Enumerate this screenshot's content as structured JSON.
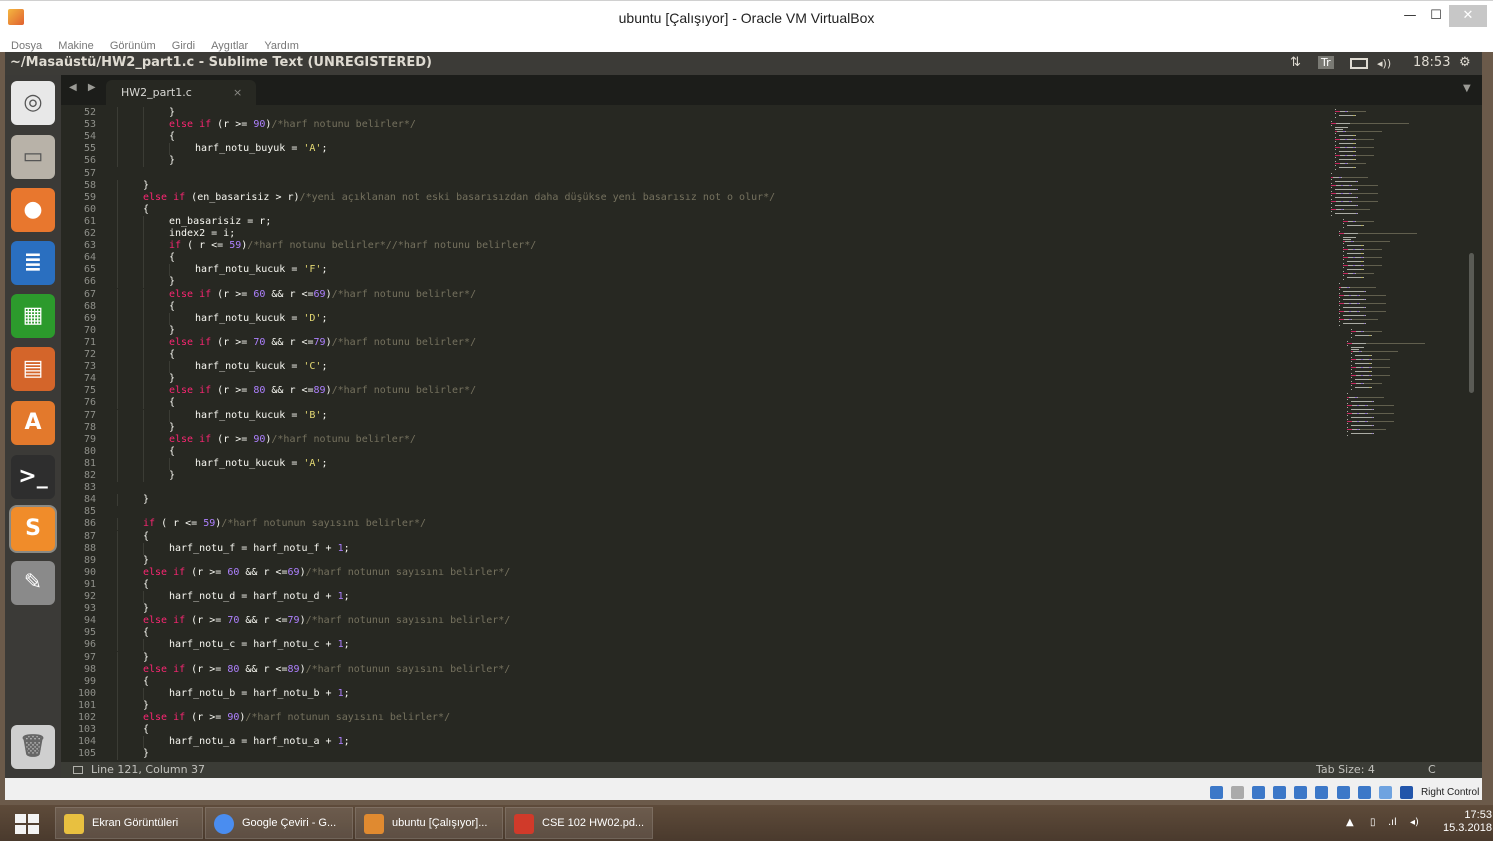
{
  "window": {
    "title": "ubuntu [Çalışıyor] - Oracle VM VirtualBox",
    "min": "—",
    "max": "☐",
    "close": "✕"
  },
  "vb_menu": [
    "Dosya",
    "Makine",
    "Görünüm",
    "Girdi",
    "Aygıtlar",
    "Yardım"
  ],
  "panel": {
    "title": "~/Masaüstü/HW2_part1.c - Sublime Text (UNREGISTERED)",
    "network": "⇅",
    "keyboard": "Tr",
    "volume": "◂))",
    "time": "18:53",
    "settings": "⚙"
  },
  "launcher": [
    {
      "name": "ubuntu-dash-icon",
      "glyph": "◎",
      "color": "#e8e8e8"
    },
    {
      "name": "files-icon",
      "glyph": "▭",
      "color": "#b8b2a8"
    },
    {
      "name": "firefox-icon",
      "glyph": "●",
      "color": "#e8772e"
    },
    {
      "name": "writer-icon",
      "glyph": "≣",
      "color": "#2a6fc0"
    },
    {
      "name": "calc-icon",
      "glyph": "▦",
      "color": "#2c9a2c"
    },
    {
      "name": "impress-icon",
      "glyph": "▤",
      "color": "#d4652a"
    },
    {
      "name": "software-center-icon",
      "glyph": "A",
      "color": "#e3792c"
    },
    {
      "name": "terminal-icon",
      "glyph": ">_",
      "color": "#2e2e2e"
    },
    {
      "name": "sublime-text-icon",
      "glyph": "S",
      "color": "#f08c2a"
    },
    {
      "name": "system-settings-icon",
      "glyph": "✎",
      "color": "#8a8a8a"
    }
  ],
  "launcher_trash": {
    "name": "trash-icon",
    "glyph": "🗑"
  },
  "tabs": {
    "nav": "◀ ▶",
    "active": "HW2_part1.c",
    "close": "×",
    "dropdown": "▼"
  },
  "editor": {
    "lines": [
      {
        "n": "52",
        "indent": 2,
        "t": [
          [
            "p",
            "}"
          ]
        ]
      },
      {
        "n": "53",
        "indent": 2,
        "t": [
          [
            "k",
            "else if"
          ],
          [
            "p",
            " (r >= "
          ],
          [
            "n",
            "90"
          ],
          [
            "p",
            ")"
          ],
          [
            "c",
            "/*harf notunu belirler*/"
          ]
        ]
      },
      {
        "n": "54",
        "indent": 2,
        "t": [
          [
            "p",
            "{"
          ]
        ]
      },
      {
        "n": "55",
        "indent": 3,
        "t": [
          [
            "p",
            "harf_notu_buyuk = "
          ],
          [
            "s",
            "'A'"
          ],
          [
            "p",
            ";"
          ]
        ]
      },
      {
        "n": "56",
        "indent": 2,
        "t": [
          [
            "p",
            "}"
          ]
        ]
      },
      {
        "n": "57",
        "indent": 0,
        "t": []
      },
      {
        "n": "58",
        "indent": 1,
        "t": [
          [
            "p",
            "}"
          ]
        ]
      },
      {
        "n": "59",
        "indent": 1,
        "t": [
          [
            "k",
            "else if"
          ],
          [
            "p",
            " (en_basarisiz > r)"
          ],
          [
            "c",
            "/*yeni açıklanan not eski basarısızdan daha düşükse yeni basarısız not o olur*/"
          ]
        ]
      },
      {
        "n": "60",
        "indent": 1,
        "t": [
          [
            "p",
            "{"
          ]
        ]
      },
      {
        "n": "61",
        "indent": 2,
        "t": [
          [
            "p",
            "en_basarisiz = r;"
          ]
        ]
      },
      {
        "n": "62",
        "indent": 2,
        "t": [
          [
            "p",
            "index2 = i;"
          ]
        ]
      },
      {
        "n": "63",
        "indent": 2,
        "t": [
          [
            "k",
            "if"
          ],
          [
            "p",
            " ( r <= "
          ],
          [
            "n",
            "59"
          ],
          [
            "p",
            ")"
          ],
          [
            "c",
            "/*harf notunu belirler*//*harf notunu belirler*/"
          ]
        ]
      },
      {
        "n": "64",
        "indent": 2,
        "t": [
          [
            "p",
            "{"
          ]
        ]
      },
      {
        "n": "65",
        "indent": 3,
        "t": [
          [
            "p",
            "harf_notu_kucuk = "
          ],
          [
            "s",
            "'F'"
          ],
          [
            "p",
            ";"
          ]
        ]
      },
      {
        "n": "66",
        "indent": 2,
        "t": [
          [
            "p",
            "}"
          ]
        ]
      },
      {
        "n": "67",
        "indent": 2,
        "t": [
          [
            "k",
            "else if"
          ],
          [
            "p",
            " (r >= "
          ],
          [
            "n",
            "60"
          ],
          [
            "p",
            " && r <="
          ],
          [
            "n",
            "69"
          ],
          [
            "p",
            ")"
          ],
          [
            "c",
            "/*harf notunu belirler*/"
          ]
        ]
      },
      {
        "n": "68",
        "indent": 2,
        "t": [
          [
            "p",
            "{"
          ]
        ]
      },
      {
        "n": "69",
        "indent": 3,
        "t": [
          [
            "p",
            "harf_notu_kucuk = "
          ],
          [
            "s",
            "'D'"
          ],
          [
            "p",
            ";"
          ]
        ]
      },
      {
        "n": "70",
        "indent": 2,
        "t": [
          [
            "p",
            "}"
          ]
        ]
      },
      {
        "n": "71",
        "indent": 2,
        "t": [
          [
            "k",
            "else if"
          ],
          [
            "p",
            " (r >= "
          ],
          [
            "n",
            "70"
          ],
          [
            "p",
            " && r <="
          ],
          [
            "n",
            "79"
          ],
          [
            "p",
            ")"
          ],
          [
            "c",
            "/*harf notunu belirler*/"
          ]
        ]
      },
      {
        "n": "72",
        "indent": 2,
        "t": [
          [
            "p",
            "{"
          ]
        ]
      },
      {
        "n": "73",
        "indent": 3,
        "t": [
          [
            "p",
            "harf_notu_kucuk = "
          ],
          [
            "s",
            "'C'"
          ],
          [
            "p",
            ";"
          ]
        ]
      },
      {
        "n": "74",
        "indent": 2,
        "t": [
          [
            "p",
            "}"
          ]
        ]
      },
      {
        "n": "75",
        "indent": 2,
        "t": [
          [
            "k",
            "else if"
          ],
          [
            "p",
            " (r >= "
          ],
          [
            "n",
            "80"
          ],
          [
            "p",
            " && r <="
          ],
          [
            "n",
            "89"
          ],
          [
            "p",
            ")"
          ],
          [
            "c",
            "/*harf notunu belirler*/"
          ]
        ]
      },
      {
        "n": "76",
        "indent": 2,
        "t": [
          [
            "p",
            "{"
          ]
        ]
      },
      {
        "n": "77",
        "indent": 3,
        "t": [
          [
            "p",
            "harf_notu_kucuk = "
          ],
          [
            "s",
            "'B'"
          ],
          [
            "p",
            ";"
          ]
        ]
      },
      {
        "n": "78",
        "indent": 2,
        "t": [
          [
            "p",
            "}"
          ]
        ]
      },
      {
        "n": "79",
        "indent": 2,
        "t": [
          [
            "k",
            "else if"
          ],
          [
            "p",
            " (r >= "
          ],
          [
            "n",
            "90"
          ],
          [
            "p",
            ")"
          ],
          [
            "c",
            "/*harf notunu belirler*/"
          ]
        ]
      },
      {
        "n": "80",
        "indent": 2,
        "t": [
          [
            "p",
            "{"
          ]
        ]
      },
      {
        "n": "81",
        "indent": 3,
        "t": [
          [
            "p",
            "harf_notu_kucuk = "
          ],
          [
            "s",
            "'A'"
          ],
          [
            "p",
            ";"
          ]
        ]
      },
      {
        "n": "82",
        "indent": 2,
        "t": [
          [
            "p",
            "}"
          ]
        ]
      },
      {
        "n": "83",
        "indent": 0,
        "t": []
      },
      {
        "n": "84",
        "indent": 1,
        "t": [
          [
            "p",
            "}"
          ]
        ]
      },
      {
        "n": "85",
        "indent": 0,
        "t": []
      },
      {
        "n": "86",
        "indent": 1,
        "t": [
          [
            "k",
            "if"
          ],
          [
            "p",
            " ( r <= "
          ],
          [
            "n",
            "59"
          ],
          [
            "p",
            ")"
          ],
          [
            "c",
            "/*harf notunun sayısını belirler*/"
          ]
        ]
      },
      {
        "n": "87",
        "indent": 1,
        "t": [
          [
            "p",
            "{"
          ]
        ]
      },
      {
        "n": "88",
        "indent": 2,
        "t": [
          [
            "p",
            "harf_notu_f = harf_notu_f + "
          ],
          [
            "n",
            "1"
          ],
          [
            "p",
            ";"
          ]
        ]
      },
      {
        "n": "89",
        "indent": 1,
        "t": [
          [
            "p",
            "}"
          ]
        ]
      },
      {
        "n": "90",
        "indent": 1,
        "t": [
          [
            "k",
            "else if"
          ],
          [
            "p",
            " (r >= "
          ],
          [
            "n",
            "60"
          ],
          [
            "p",
            " && r <="
          ],
          [
            "n",
            "69"
          ],
          [
            "p",
            ")"
          ],
          [
            "c",
            "/*harf notunun sayısını belirler*/"
          ]
        ]
      },
      {
        "n": "91",
        "indent": 1,
        "t": [
          [
            "p",
            "{"
          ]
        ]
      },
      {
        "n": "92",
        "indent": 2,
        "t": [
          [
            "p",
            "harf_notu_d = harf_notu_d + "
          ],
          [
            "n",
            "1"
          ],
          [
            "p",
            ";"
          ]
        ]
      },
      {
        "n": "93",
        "indent": 1,
        "t": [
          [
            "p",
            "}"
          ]
        ]
      },
      {
        "n": "94",
        "indent": 1,
        "t": [
          [
            "k",
            "else if"
          ],
          [
            "p",
            " (r >= "
          ],
          [
            "n",
            "70"
          ],
          [
            "p",
            " && r <="
          ],
          [
            "n",
            "79"
          ],
          [
            "p",
            ")"
          ],
          [
            "c",
            "/*harf notunun sayısını belirler*/"
          ]
        ]
      },
      {
        "n": "95",
        "indent": 1,
        "t": [
          [
            "p",
            "{"
          ]
        ]
      },
      {
        "n": "96",
        "indent": 2,
        "t": [
          [
            "p",
            "harf_notu_c = harf_notu_c + "
          ],
          [
            "n",
            "1"
          ],
          [
            "p",
            ";"
          ]
        ]
      },
      {
        "n": "97",
        "indent": 1,
        "t": [
          [
            "p",
            "}"
          ]
        ]
      },
      {
        "n": "98",
        "indent": 1,
        "t": [
          [
            "k",
            "else if"
          ],
          [
            "p",
            " (r >= "
          ],
          [
            "n",
            "80"
          ],
          [
            "p",
            " && r <="
          ],
          [
            "n",
            "89"
          ],
          [
            "p",
            ")"
          ],
          [
            "c",
            "/*harf notunun sayısını belirler*/"
          ]
        ]
      },
      {
        "n": "99",
        "indent": 1,
        "t": [
          [
            "p",
            "{"
          ]
        ]
      },
      {
        "n": "100",
        "indent": 2,
        "t": [
          [
            "p",
            "harf_notu_b = harf_notu_b + "
          ],
          [
            "n",
            "1"
          ],
          [
            "p",
            ";"
          ]
        ]
      },
      {
        "n": "101",
        "indent": 1,
        "t": [
          [
            "p",
            "}"
          ]
        ]
      },
      {
        "n": "102",
        "indent": 1,
        "t": [
          [
            "k",
            "else if"
          ],
          [
            "p",
            " (r >= "
          ],
          [
            "n",
            "90"
          ],
          [
            "p",
            ")"
          ],
          [
            "c",
            "/*harf notunun sayısını belirler*/"
          ]
        ]
      },
      {
        "n": "103",
        "indent": 1,
        "t": [
          [
            "p",
            "{"
          ]
        ]
      },
      {
        "n": "104",
        "indent": 2,
        "t": [
          [
            "p",
            "harf_notu_a = harf_notu_a + "
          ],
          [
            "n",
            "1"
          ],
          [
            "p",
            ";"
          ]
        ]
      },
      {
        "n": "105",
        "indent": 1,
        "t": [
          [
            "p",
            "}"
          ]
        ]
      }
    ]
  },
  "statusbar": {
    "position": "Line 121, Column 37",
    "tab_size": "Tab Size: 4",
    "syntax": "C"
  },
  "vb_status": {
    "host_key": "Right Control"
  },
  "taskbar": {
    "items": [
      {
        "name": "taskbar-item-explorer",
        "label": "Ekran Görüntüleri",
        "color": "#e8c040"
      },
      {
        "name": "taskbar-item-chrome",
        "label": "Google Çeviri - G...",
        "color": "#4a8df0"
      },
      {
        "name": "taskbar-item-virtualbox",
        "label": "ubuntu [Çalışıyor]...",
        "color": "#e08a30"
      },
      {
        "name": "taskbar-item-pdf",
        "label": "CSE 102 HW02.pd...",
        "color": "#d03a2a"
      }
    ],
    "time": "17:53",
    "date": "15.3.2018"
  }
}
